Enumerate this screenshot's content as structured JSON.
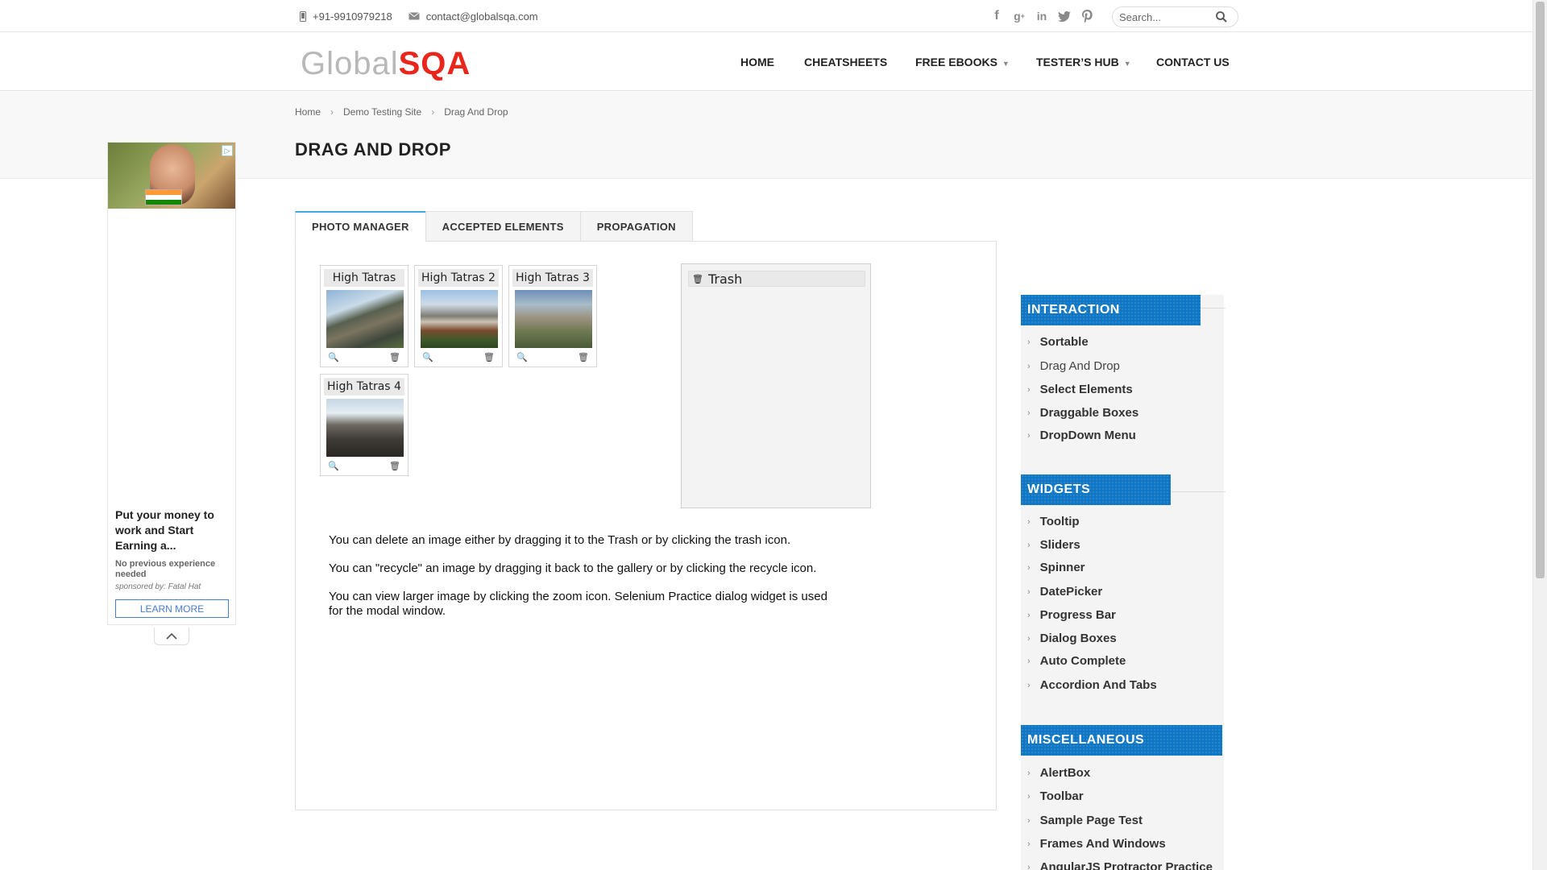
{
  "topbar": {
    "phone": "+91-9910979218",
    "email": "contact@globalsqa.com",
    "social": [
      "facebook-icon",
      "google-plus-icon",
      "linkedin-icon",
      "twitter-icon",
      "pinterest-icon"
    ],
    "search_placeholder": "Search..."
  },
  "logo": {
    "part1": "Global",
    "part2": "SQA"
  },
  "nav": {
    "home": "HOME",
    "cheatsheets": "CHEATSHEETS",
    "free_ebooks": "FREE EBOOKS",
    "testers_hub": "TESTER’S HUB",
    "contact": "CONTACT US"
  },
  "breadcrumb": {
    "home": "Home",
    "demo": "Demo Testing Site",
    "current": "Drag And Drop"
  },
  "page_title": "DRAG AND DROP",
  "ad": {
    "headline": "Put your money to work and Start Earning a...",
    "sub": "No previous experience needed",
    "sponsor": "sponsored by: Fatal Hat",
    "cta": "LEARN MORE"
  },
  "tabs": [
    "PHOTO MANAGER",
    "ACCEPTED ELEMENTS",
    "PROPAGATION"
  ],
  "gallery": [
    {
      "title": "High Tatras"
    },
    {
      "title": "High Tatras 2"
    },
    {
      "title": "High Tatras 3"
    },
    {
      "title": "High Tatras 4"
    }
  ],
  "trash_title": "Trash",
  "info": [
    "You can delete an image either by dragging it to the Trash or by clicking the trash icon.",
    "You can \"recycle\" an image by dragging it back to the gallery or by clicking the recycle icon.",
    "You can view larger image by clicking the zoom icon. Selenium Practice dialog widget is used for the modal window."
  ],
  "sidebar": {
    "interaction": {
      "title": "INTERACTION",
      "items": [
        "Sortable",
        "Drag And Drop",
        "Select Elements",
        "Draggable Boxes",
        "DropDown Menu"
      ]
    },
    "widgets": {
      "title": "WIDGETS",
      "items": [
        "Tooltip",
        "Sliders",
        "Spinner",
        "DatePicker",
        "Progress Bar",
        "Dialog Boxes",
        "Auto Complete",
        "Accordion And Tabs"
      ]
    },
    "misc": {
      "title": "MISCELLANEOUS",
      "items": [
        "AlertBox",
        "Toolbar",
        "Sample Page Test",
        "Frames And Windows",
        "AngularJS Protractor Practice"
      ]
    }
  },
  "colors": {
    "accent": "#1077c4",
    "tab_active": "#3fa9e3",
    "logo_red": "#e8261c",
    "logo_yellow": "#f2b705"
  }
}
